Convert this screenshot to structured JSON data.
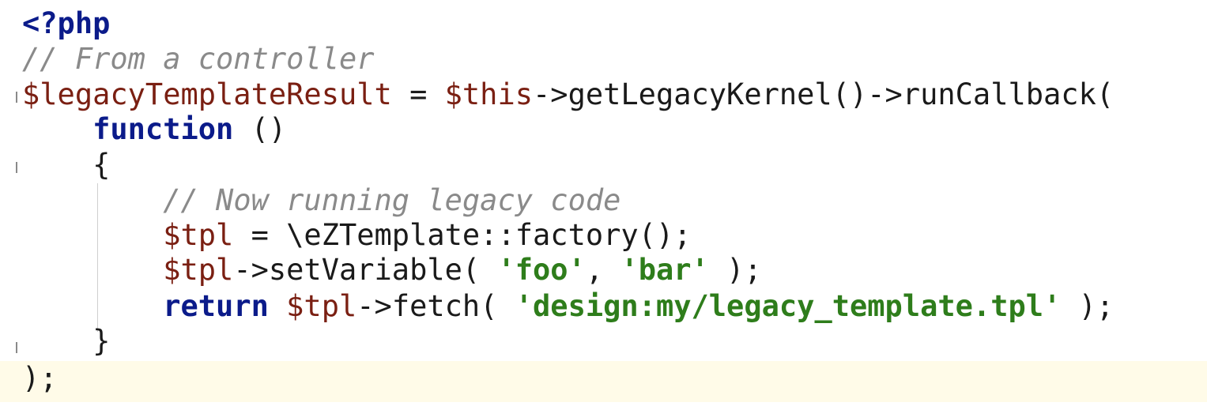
{
  "lines": [
    {
      "t": [
        {
          "c": "kw",
          "v": "<?php"
        }
      ]
    },
    {
      "t": [
        {
          "c": "cmt",
          "v": "// From a controller"
        }
      ]
    },
    {
      "t": [
        {
          "c": "var",
          "v": "$legacyTemplateResult"
        },
        {
          "c": "plain",
          "v": " = "
        },
        {
          "c": "var",
          "v": "$this"
        },
        {
          "c": "plain",
          "v": "->getLegacyKernel()->runCallback("
        }
      ]
    },
    {
      "t": [
        {
          "c": "plain",
          "v": "    "
        },
        {
          "c": "kw",
          "v": "function"
        },
        {
          "c": "plain",
          "v": " ()"
        }
      ]
    },
    {
      "t": [
        {
          "c": "plain",
          "v": "    {"
        }
      ]
    },
    {
      "t": [
        {
          "c": "plain",
          "v": "        "
        },
        {
          "c": "cmt",
          "v": "// Now running legacy code"
        }
      ]
    },
    {
      "t": [
        {
          "c": "plain",
          "v": "        "
        },
        {
          "c": "var",
          "v": "$tpl"
        },
        {
          "c": "plain",
          "v": " = \\eZTemplate::factory();"
        }
      ]
    },
    {
      "t": [
        {
          "c": "plain",
          "v": "        "
        },
        {
          "c": "var",
          "v": "$tpl"
        },
        {
          "c": "plain",
          "v": "->setVariable( "
        },
        {
          "c": "str",
          "v": "'foo'"
        },
        {
          "c": "plain",
          "v": ", "
        },
        {
          "c": "str",
          "v": "'bar'"
        },
        {
          "c": "plain",
          "v": " );"
        }
      ]
    },
    {
      "t": [
        {
          "c": "plain",
          "v": "        "
        },
        {
          "c": "kw",
          "v": "return"
        },
        {
          "c": "plain",
          "v": " "
        },
        {
          "c": "var",
          "v": "$tpl"
        },
        {
          "c": "plain",
          "v": "->fetch( "
        },
        {
          "c": "str",
          "v": "'design:my/legacy_template.tpl'"
        },
        {
          "c": "plain",
          "v": " );"
        }
      ]
    },
    {
      "t": [
        {
          "c": "plain",
          "v": "    }"
        }
      ]
    },
    {
      "t": [
        {
          "c": "plain",
          "v": ");"
        }
      ]
    }
  ],
  "current_line": 10
}
